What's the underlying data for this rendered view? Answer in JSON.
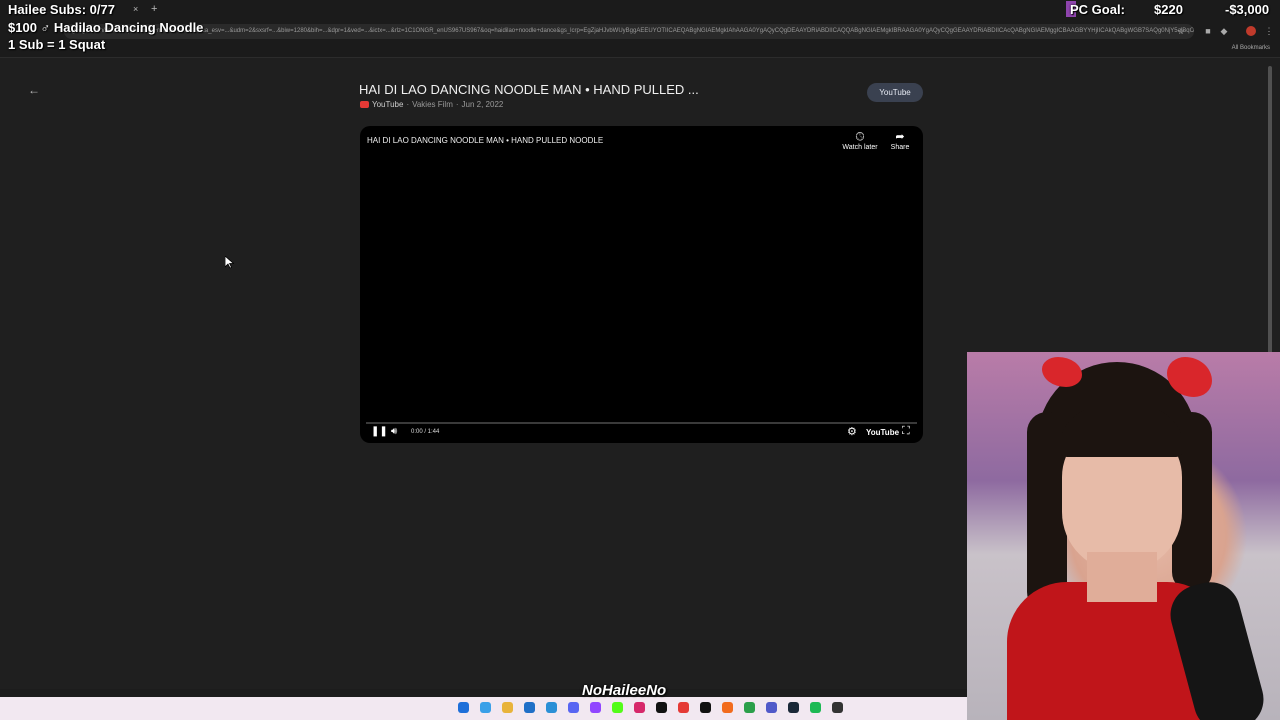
{
  "overlay": {
    "subs": "Hailee Subs: 0/77",
    "goal": "$100 ♂ Hadilao Dancing Noodle",
    "rule": "1 Sub = 1 Squat",
    "pc_goal_label": "PC Goal:",
    "pc_current": "$220",
    "pc_target": "-$3,000",
    "watermark": "NoHaileeNo"
  },
  "browser": {
    "url": "google.com/search?q=haidilao+noodle+dance&sca_esv=...&udm=2&sxsrf=...&biw=1280&bih=...&dpr=1&ved=...&ictx=...&rlz=1C1ONGR_enUS967US967&oq=haidilao+noodle+dance&gs_lcrp=EgZjaHJvbWUyBggAEEUYOTIICAEQABgNGIAEMgkIAhAAGA0YgAQyCQgDEAAYDRiABDIICAQQABgNGIAEMgkIBRAAGA0YgAQyCQgGEAAYDRiABDIICAcQABgNGIAEMggICBAAGBYYHjIICAkQABgWGB7SAQg0NjY5ajBqOagCBrACAfEFIFE...",
    "all_bookmarks": "All Bookmarks",
    "tab_close": "×",
    "tab_new": "+"
  },
  "page": {
    "back": "←",
    "video_title": "HAI DI LAO DANCING NOODLE MAN • HAND PULLED ...",
    "source": "YouTube",
    "channel": "Vakies Film",
    "date": "Jun 2, 2022",
    "meta_sep": "·",
    "open_button": "YouTube"
  },
  "player": {
    "embed_title": "HAI DI LAO DANCING NOODLE MAN • HAND PULLED NOODLE",
    "watch_later": "Watch later",
    "share": "Share",
    "time": "0:00 / 1:44",
    "logo": "YouTube",
    "progress": 0.0
  },
  "taskbar": {
    "icons": [
      "windows-icon",
      "copilot-icon",
      "files-icon",
      "outlook-icon",
      "edge-icon",
      "discord-icon",
      "twitch-icon",
      "kick-icon",
      "instagram-icon",
      "tiktok-icon",
      "youtube-icon",
      "x-icon",
      "firefox-icon",
      "chrome-icon",
      "teams-icon",
      "steam-icon",
      "spotify-icon",
      "obs-icon"
    ]
  },
  "colors": {
    "page_bg": "#1f1f1f",
    "player_bg": "#000000",
    "pill_bg": "#3a4150",
    "youtube_red": "#e53935",
    "taskbar_bg": "#f2e8f1"
  }
}
